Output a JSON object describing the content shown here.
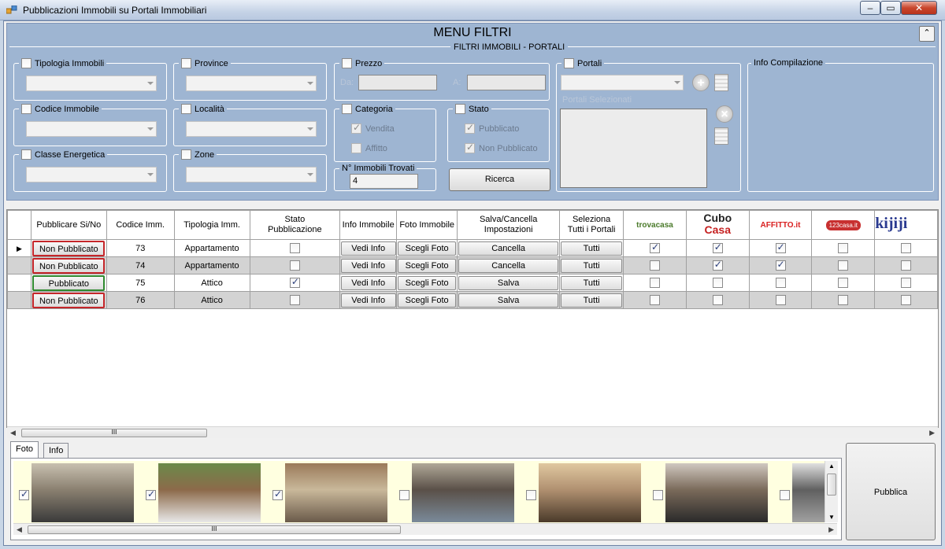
{
  "window": {
    "title": "Pubblicazioni Immobili su Portali Immobiliari",
    "minimize_glyph": "‒",
    "maximize_glyph": "▭",
    "close_glyph": "✕"
  },
  "filters": {
    "menu_title": "MENU FILTRI",
    "collapse_glyph": "⌃",
    "subtitle": "FILTRI IMMOBILI - PORTALI",
    "tipologia": "Tipologia Immobili",
    "codice": "Codice Immobile",
    "classe": "Classe Energetica",
    "province": "Province",
    "localita": "Località",
    "zone": "Zone",
    "prezzo": "Prezzo",
    "prezzo_da": "Da:",
    "prezzo_a": "A:",
    "categoria": "Categoria",
    "categoria_vendita": "Vendita",
    "categoria_affitto": "Affitto",
    "stato": "Stato",
    "stato_pubblicato": "Pubblicato",
    "stato_non_pubblicato": "Non Pubblicato",
    "trovati_label": "N° Immobili Trovati",
    "trovati_value": "4",
    "ricerca": "Ricerca",
    "portali": "Portali",
    "portali_selezionati": "Portali Selezionati",
    "info_compilazione": "Info Compilazione"
  },
  "grid": {
    "columns": {
      "pubblicare": "Pubblicare Si/No",
      "codice": "Codice Imm.",
      "tipologia": "Tipologia Imm.",
      "stato_1": "Stato",
      "stato_2": "Pubblicazione",
      "info": "Info Immobile",
      "foto": "Foto Immobile",
      "salva_1": "Salva/Cancella",
      "salva_2": "Impostazioni",
      "seleziona_1": "Seleziona",
      "seleziona_2": "Tutti i Portali",
      "portal_1": "trovacasa",
      "portal_2a": "Cubo",
      "portal_2b": "Casa",
      "portal_3": "AFFITTO.it",
      "portal_4": "123casa.it",
      "portal_5": "kijiji"
    },
    "rows": [
      {
        "status": "Non Pubblicato",
        "status_color": "#c5262a",
        "codice": "73",
        "tipologia": "Appartamento",
        "pubblicato": false,
        "info": "Vedi Info",
        "foto": "Scegli Foto",
        "salva": "Cancella",
        "tutti": "Tutti",
        "portals": [
          true,
          true,
          true,
          false,
          false
        ]
      },
      {
        "status": "Non Pubblicato",
        "status_color": "#c5262a",
        "codice": "74",
        "tipologia": "Appartamento",
        "pubblicato": false,
        "info": "Vedi Info",
        "foto": "Scegli Foto",
        "salva": "Cancella",
        "tutti": "Tutti",
        "portals": [
          false,
          true,
          true,
          false,
          false
        ]
      },
      {
        "status": "Pubblicato",
        "status_color": "#2f8a2f",
        "codice": "75",
        "tipologia": "Attico",
        "pubblicato": true,
        "info": "Vedi Info",
        "foto": "Scegli Foto",
        "salva": "Salva",
        "tutti": "Tutti",
        "portals": [
          false,
          false,
          false,
          false,
          false
        ]
      },
      {
        "status": "Non Pubblicato",
        "status_color": "#c5262a",
        "codice": "76",
        "tipologia": "Attico",
        "pubblicato": false,
        "info": "Vedi Info",
        "foto": "Scegli Foto",
        "salva": "Salva",
        "tutti": "Tutti",
        "portals": [
          false,
          false,
          false,
          false,
          false
        ]
      }
    ],
    "scroll_grip": "III"
  },
  "bottom": {
    "tab_foto": "Foto",
    "tab_info": "Info",
    "photo_checks": [
      true,
      true,
      true,
      false,
      false,
      false,
      false
    ],
    "pubblica": "Pubblica"
  }
}
